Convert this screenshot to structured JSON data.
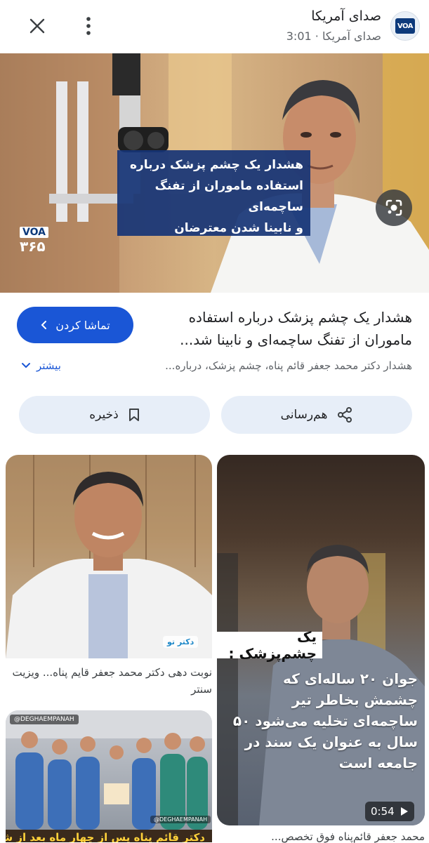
{
  "header": {
    "title": "صدای آمریکا",
    "subtitle": "صدای آمریکا · 3:01",
    "logo_text": "VOA"
  },
  "hero": {
    "caption_lines": [
      "هشدار یک چشم پزشک درباره",
      "استفاده ماموران از تفنگ ساچمه‌ای",
      "و نابینا شدن معترضان"
    ],
    "badge_top": "VOA",
    "badge_bottom": "۳۶۵"
  },
  "result": {
    "title": "هشدار یک چشم پزشک درباره استفاده ماموران از تفنگ ساچمه‌ای و نابینا شد...",
    "watch_label": "تماشا کردن",
    "snippet": "هشدار دکتر محمد جعفر قائم پناه، چشم پزشک، درباره...",
    "more_label": "بیشتر"
  },
  "actions": {
    "share_label": "هم‌رسانی",
    "save_label": "ذخیره"
  },
  "cards": {
    "card1_caption": "نوبت دهی دکتر محمد جعفر قایم پناه... ویزیت سنتر",
    "card1_watermark": "دکتر تو",
    "card2_label": "یک چشم‌پزشک :",
    "card2_text": "جوان ۲۰ ساله‌ای که چشمش بخاطر تیر ساچمه‌ای تخلیه می‌شود ۵۰ سال به عنوان یک سند در جامعه است",
    "card2_duration": "0:54",
    "card2_caption": "محمد جعفر قائم‌پناه فوق تخصص...",
    "card3_tag": "@DEGHAEMPANAH",
    "card3_banner": "دکتر قائم پناه پس از چهار ماه بعد از شرکت"
  },
  "colors": {
    "accent": "#1a56d6",
    "pill_bg": "#e7eef8",
    "caption_bg": "#163476"
  }
}
